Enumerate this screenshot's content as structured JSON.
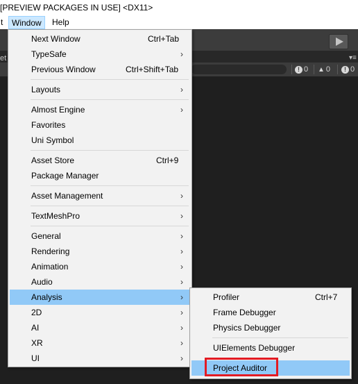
{
  "title_bar": {
    "text": "[PREVIEW PACKAGES IN USE] <DX11>"
  },
  "menu_bar": [
    {
      "label": "t"
    },
    {
      "label": "Window"
    },
    {
      "label": "Help"
    }
  ],
  "editor": {
    "left_label": "et",
    "right_icon": "▾≡",
    "console_counters": [
      {
        "icon": "!",
        "count": "0"
      },
      {
        "icon": "▲",
        "count": "0"
      },
      {
        "icon": "!",
        "count": "0"
      }
    ]
  },
  "window_menu": [
    {
      "label": "Next Window",
      "shortcut": "Ctrl+Tab"
    },
    {
      "label": "TypeSafe",
      "arrow": "›"
    },
    {
      "label": "Previous Window",
      "shortcut": "Ctrl+Shift+Tab"
    },
    {
      "label": "Layouts",
      "arrow": "›"
    },
    {
      "label": "Almost Engine",
      "arrow": "›"
    },
    {
      "label": "Favorites"
    },
    {
      "label": "Uni Symbol"
    },
    {
      "label": "Asset Store",
      "shortcut": "Ctrl+9"
    },
    {
      "label": "Package Manager"
    },
    {
      "label": "Asset Management",
      "arrow": "›"
    },
    {
      "label": "TextMeshPro",
      "arrow": "›"
    },
    {
      "label": "General",
      "arrow": "›"
    },
    {
      "label": "Rendering",
      "arrow": "›"
    },
    {
      "label": "Animation",
      "arrow": "›"
    },
    {
      "label": "Audio",
      "arrow": "›"
    },
    {
      "label": "Analysis",
      "arrow": "›",
      "highlighted": true
    },
    {
      "label": "2D",
      "arrow": "›"
    },
    {
      "label": "AI",
      "arrow": "›"
    },
    {
      "label": "XR",
      "arrow": "›"
    },
    {
      "label": "UI",
      "arrow": "›"
    }
  ],
  "analysis_submenu": [
    {
      "label": "Profiler",
      "shortcut": "Ctrl+7"
    },
    {
      "label": "Frame Debugger"
    },
    {
      "label": "Physics Debugger"
    },
    {
      "label": "UIElements Debugger"
    },
    {
      "label": "Project Auditor",
      "highlighted": true,
      "annotated": true
    }
  ],
  "colors": {
    "menu_bg": "#f2f2f2",
    "highlight": "#91c9f7",
    "annotation": "#e31b23",
    "editor_dark": "#282828"
  }
}
